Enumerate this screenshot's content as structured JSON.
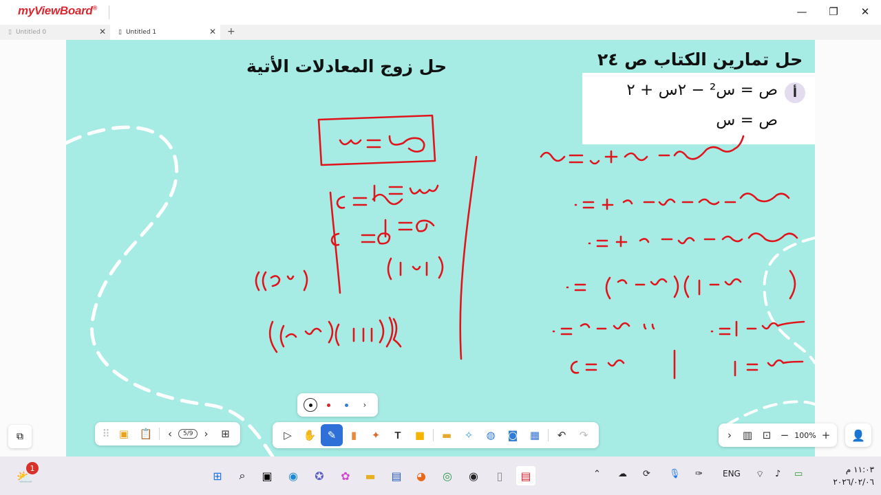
{
  "app": {
    "logo": "myViewBoard",
    "tabs": [
      {
        "label": "Untitled 0",
        "active": false
      },
      {
        "label": "Untitled 1",
        "active": true
      }
    ]
  },
  "board": {
    "background_color": "#a6ece5",
    "ink_color": "#e0141b",
    "title_left": "حل زوج المعادلات الأتية",
    "title_right": "حل تمارين الكتاب ص ٢٤",
    "exercise": {
      "badge": "أ",
      "line1": "ص = س² − ٢س + ٢",
      "line2": "ص = س"
    }
  },
  "toolbar": {
    "page_indicator": "5/9",
    "zoom": "100%"
  },
  "palette": {
    "colors": [
      "#111111",
      "#d62626",
      "#3b7bd8"
    ]
  },
  "taskbar": {
    "notification_count": "1",
    "language": "ENG",
    "time": "١١:٠٣ م",
    "date": "٢٠٢٦/٠٢/٠٦"
  }
}
